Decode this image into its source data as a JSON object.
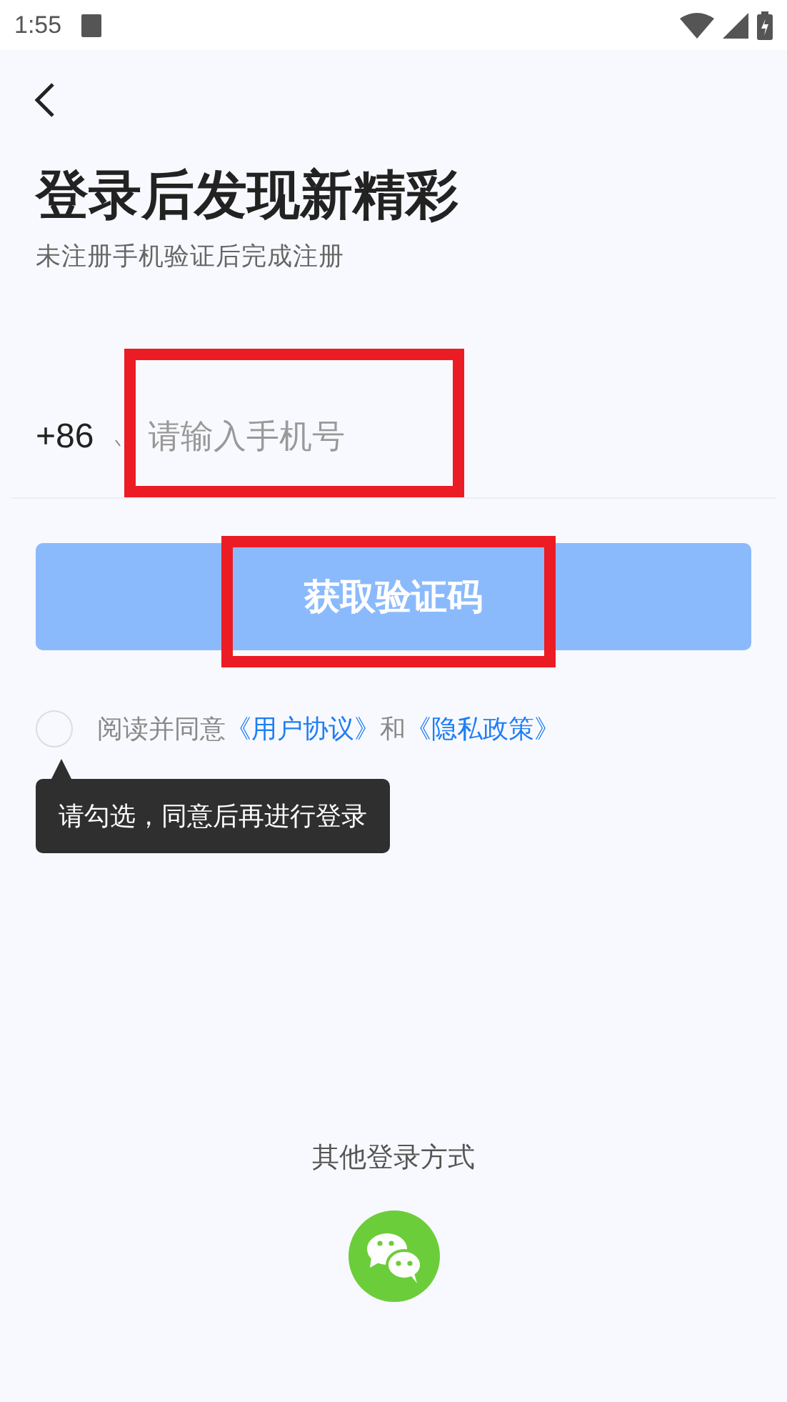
{
  "status_bar": {
    "time": "1:55"
  },
  "title": "登录后发现新精彩",
  "subtitle": "未注册手机验证后完成注册",
  "phone": {
    "country_code": "+86",
    "placeholder": "请输入手机号",
    "highlighted": true
  },
  "get_code_button": {
    "label": "获取验证码",
    "disabled": true,
    "highlighted": true
  },
  "agreement": {
    "checked": false,
    "parts": [
      {
        "kind": "text",
        "text": "阅读并同意"
      },
      {
        "kind": "link",
        "text": "《用户协议》"
      },
      {
        "kind": "text",
        "text": "和"
      },
      {
        "kind": "link",
        "text": "《隐私政策》"
      }
    ]
  },
  "tooltip": "请勾选，同意后再进行登录",
  "other_login": {
    "label": "其他登录方式"
  }
}
